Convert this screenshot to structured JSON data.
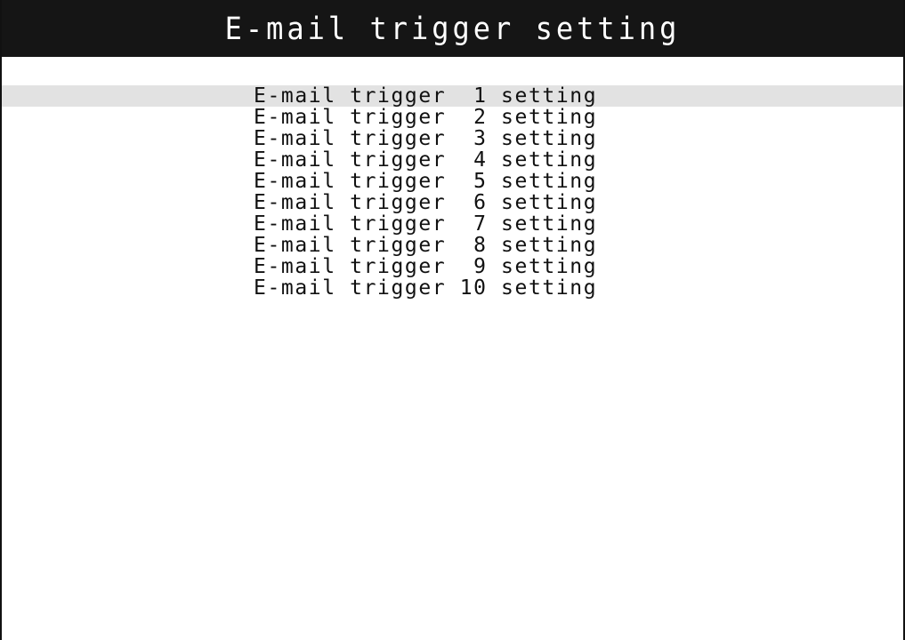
{
  "header": {
    "title": "E-mail trigger setting"
  },
  "menu": {
    "selected_index": 0,
    "items": [
      {
        "label": "E-mail trigger  1 setting"
      },
      {
        "label": "E-mail trigger  2 setting"
      },
      {
        "label": "E-mail trigger  3 setting"
      },
      {
        "label": "E-mail trigger  4 setting"
      },
      {
        "label": "E-mail trigger  5 setting"
      },
      {
        "label": "E-mail trigger  6 setting"
      },
      {
        "label": "E-mail trigger  7 setting"
      },
      {
        "label": "E-mail trigger  8 setting"
      },
      {
        "label": "E-mail trigger  9 setting"
      },
      {
        "label": "E-mail trigger 10 setting"
      }
    ]
  },
  "colors": {
    "title_bar_background": "#151515",
    "title_text": "#ffffff",
    "selection_highlight": "#e2e2e2",
    "text": "#111111",
    "background": "#ffffff"
  }
}
